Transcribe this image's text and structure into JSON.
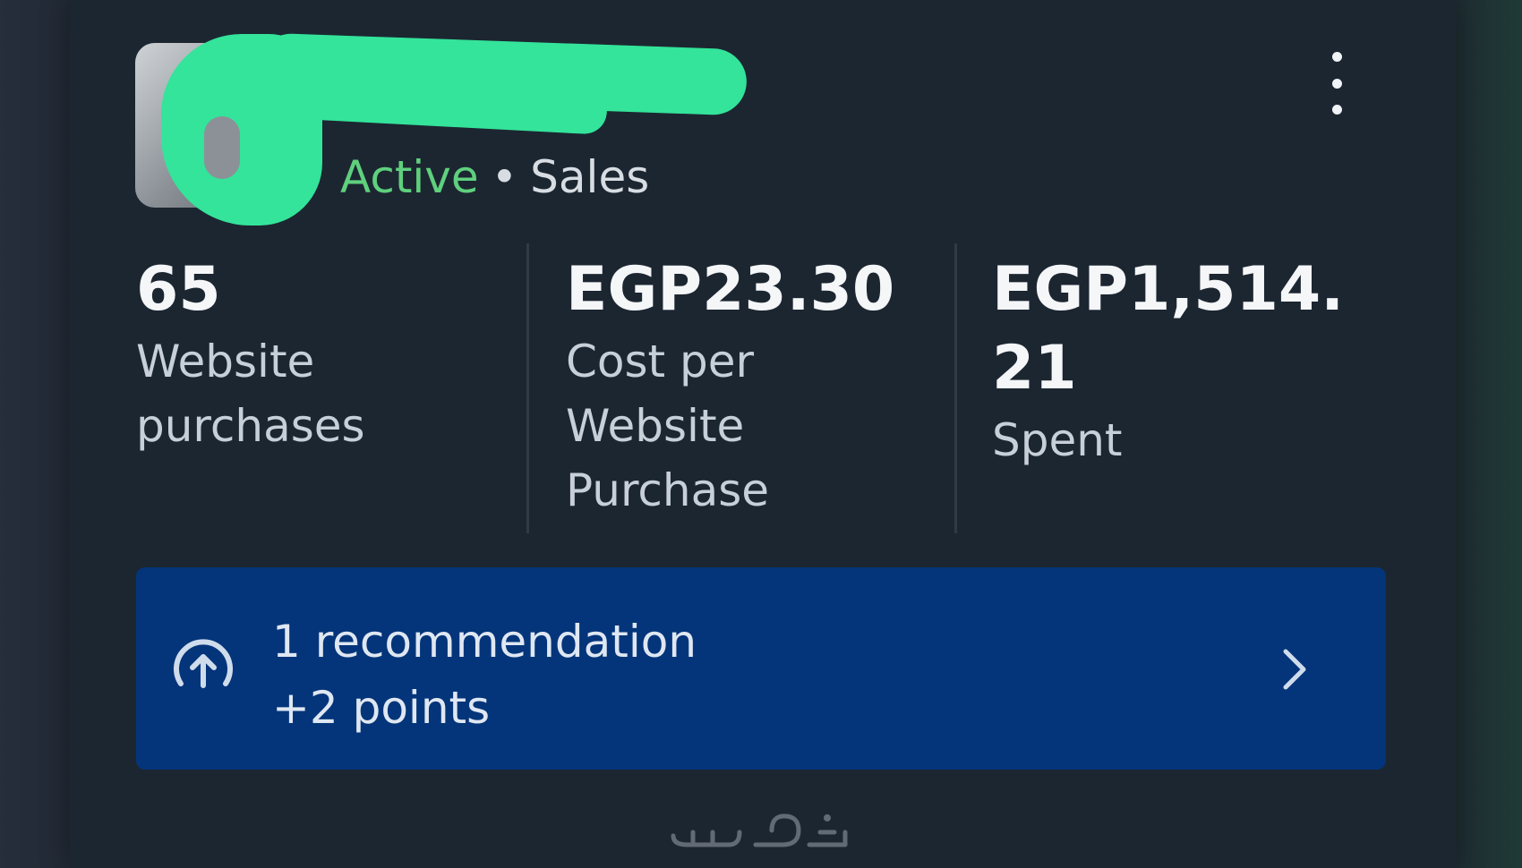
{
  "ad": {
    "status": "Active",
    "separator": "•",
    "objective": "Sales"
  },
  "metrics": [
    {
      "value": "65",
      "label": "Website purchases"
    },
    {
      "value": "EGP23.30",
      "label": "Cost per Website Purchase"
    },
    {
      "value": "EGP1,514.21",
      "label": "Spent"
    }
  ],
  "recommendation": {
    "title": "1 recommendation",
    "subtitle": "+2 points"
  },
  "icons": {
    "more": "more-vertical-icon",
    "recommendation": "arrow-up-circle-icon",
    "chevron": "chevron-right-icon"
  },
  "colors": {
    "active": "#5fd07d",
    "recommendation_bg": "#04357a",
    "card_bg": "#1c2631"
  }
}
